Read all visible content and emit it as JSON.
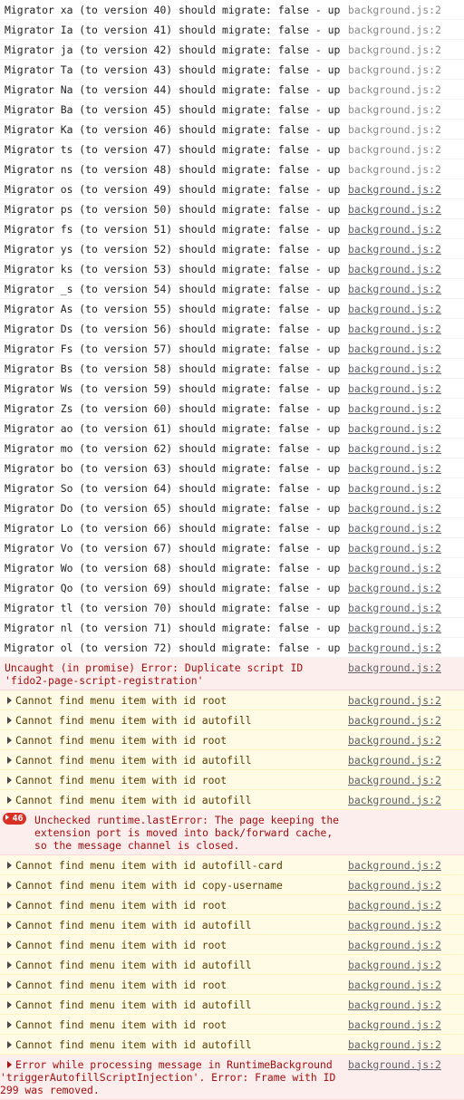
{
  "console": {
    "messages": [
      {
        "level": "log",
        "text": "Migrator xa (to version 40) should migrate: false - up",
        "source": "background.js:2",
        "link": false
      },
      {
        "level": "log",
        "text": "Migrator Ia (to version 41) should migrate: false - up",
        "source": "background.js:2",
        "link": false
      },
      {
        "level": "log",
        "text": "Migrator ja (to version 42) should migrate: false - up",
        "source": "background.js:2",
        "link": false
      },
      {
        "level": "log",
        "text": "Migrator Ta (to version 43) should migrate: false - up",
        "source": "background.js:2",
        "link": false
      },
      {
        "level": "log",
        "text": "Migrator Na (to version 44) should migrate: false - up",
        "source": "background.js:2",
        "link": false
      },
      {
        "level": "log",
        "text": "Migrator Ba (to version 45) should migrate: false - up",
        "source": "background.js:2",
        "link": false
      },
      {
        "level": "log",
        "text": "Migrator Ka (to version 46) should migrate: false - up",
        "source": "background.js:2",
        "link": false
      },
      {
        "level": "log",
        "text": "Migrator ts (to version 47) should migrate: false - up",
        "source": "background.js:2",
        "link": false
      },
      {
        "level": "log",
        "text": "Migrator ns (to version 48) should migrate: false - up",
        "source": "background.js:2",
        "link": false
      },
      {
        "level": "log",
        "text": "Migrator os (to version 49) should migrate: false - up",
        "source": "background.js:2",
        "link": true
      },
      {
        "level": "log",
        "text": "Migrator ps (to version 50) should migrate: false - up",
        "source": "background.js:2",
        "link": true
      },
      {
        "level": "log",
        "text": "Migrator fs (to version 51) should migrate: false - up",
        "source": "background.js:2",
        "link": true
      },
      {
        "level": "log",
        "text": "Migrator ys (to version 52) should migrate: false - up",
        "source": "background.js:2",
        "link": true
      },
      {
        "level": "log",
        "text": "Migrator ks (to version 53) should migrate: false - up",
        "source": "background.js:2",
        "link": true
      },
      {
        "level": "log",
        "text": "Migrator _s (to version 54) should migrate: false - up",
        "source": "background.js:2",
        "link": true
      },
      {
        "level": "log",
        "text": "Migrator As (to version 55) should migrate: false - up",
        "source": "background.js:2",
        "link": true
      },
      {
        "level": "log",
        "text": "Migrator Ds (to version 56) should migrate: false - up",
        "source": "background.js:2",
        "link": true
      },
      {
        "level": "log",
        "text": "Migrator Fs (to version 57) should migrate: false - up",
        "source": "background.js:2",
        "link": true
      },
      {
        "level": "log",
        "text": "Migrator Bs (to version 58) should migrate: false - up",
        "source": "background.js:2",
        "link": true
      },
      {
        "level": "log",
        "text": "Migrator Ws (to version 59) should migrate: false - up",
        "source": "background.js:2",
        "link": true
      },
      {
        "level": "log",
        "text": "Migrator Zs (to version 60) should migrate: false - up",
        "source": "background.js:2",
        "link": true
      },
      {
        "level": "log",
        "text": "Migrator ao (to version 61) should migrate: false - up",
        "source": "background.js:2",
        "link": true
      },
      {
        "level": "log",
        "text": "Migrator mo (to version 62) should migrate: false - up",
        "source": "background.js:2",
        "link": true
      },
      {
        "level": "log",
        "text": "Migrator bo (to version 63) should migrate: false - up",
        "source": "background.js:2",
        "link": true
      },
      {
        "level": "log",
        "text": "Migrator So (to version 64) should migrate: false - up",
        "source": "background.js:2",
        "link": true
      },
      {
        "level": "log",
        "text": "Migrator Do (to version 65) should migrate: false - up",
        "source": "background.js:2",
        "link": true
      },
      {
        "level": "log",
        "text": "Migrator Lo (to version 66) should migrate: false - up",
        "source": "background.js:2",
        "link": true
      },
      {
        "level": "log",
        "text": "Migrator Vo (to version 67) should migrate: false - up",
        "source": "background.js:2",
        "link": true
      },
      {
        "level": "log",
        "text": "Migrator Wo (to version 68) should migrate: false - up",
        "source": "background.js:2",
        "link": true
      },
      {
        "level": "log",
        "text": "Migrator Qo (to version 69) should migrate: false - up",
        "source": "background.js:2",
        "link": true
      },
      {
        "level": "log",
        "text": "Migrator tl (to version 70) should migrate: false - up",
        "source": "background.js:2",
        "link": true
      },
      {
        "level": "log",
        "text": "Migrator nl (to version 71) should migrate: false - up",
        "source": "background.js:2",
        "link": true
      },
      {
        "level": "log",
        "text": "Migrator ol (to version 72) should migrate: false - up",
        "source": "background.js:2",
        "link": true
      },
      {
        "level": "error",
        "text": "Uncaught (in promise) Error: Duplicate script ID 'fido2-page-script-registration'",
        "source": "background.js:2",
        "link": true
      },
      {
        "level": "warning",
        "text": "Cannot find menu item with id root",
        "source": "background.js:2",
        "link": true,
        "expandable": true
      },
      {
        "level": "warning",
        "text": "Cannot find menu item with id autofill",
        "source": "background.js:2",
        "link": true,
        "expandable": true
      },
      {
        "level": "warning",
        "text": "Cannot find menu item with id root",
        "source": "background.js:2",
        "link": true,
        "expandable": true
      },
      {
        "level": "warning",
        "text": "Cannot find menu item with id autofill",
        "source": "background.js:2",
        "link": true,
        "expandable": true
      },
      {
        "level": "warning",
        "text": "Cannot find menu item with id root",
        "source": "background.js:2",
        "link": true,
        "expandable": true
      },
      {
        "level": "warning",
        "text": "Cannot find menu item with id autofill",
        "source": "background.js:2",
        "link": true,
        "expandable": true
      },
      {
        "level": "error",
        "badge": "46",
        "text": "Unchecked runtime.lastError: The page keeping the extension port is moved into back/forward cache, so the message channel is closed.",
        "source": "",
        "link": false
      },
      {
        "level": "warning",
        "text": "Cannot find menu item with id autofill-card",
        "source": "background.js:2",
        "link": true,
        "expandable": true
      },
      {
        "level": "warning",
        "text": "Cannot find menu item with id copy-username",
        "source": "background.js:2",
        "link": true,
        "expandable": true
      },
      {
        "level": "warning",
        "text": "Cannot find menu item with id root",
        "source": "background.js:2",
        "link": true,
        "expandable": true
      },
      {
        "level": "warning",
        "text": "Cannot find menu item with id autofill",
        "source": "background.js:2",
        "link": true,
        "expandable": true
      },
      {
        "level": "warning",
        "text": "Cannot find menu item with id root",
        "source": "background.js:2",
        "link": true,
        "expandable": true
      },
      {
        "level": "warning",
        "text": "Cannot find menu item with id autofill",
        "source": "background.js:2",
        "link": true,
        "expandable": true
      },
      {
        "level": "warning",
        "text": "Cannot find menu item with id root",
        "source": "background.js:2",
        "link": true,
        "expandable": true
      },
      {
        "level": "warning",
        "text": "Cannot find menu item with id autofill",
        "source": "background.js:2",
        "link": true,
        "expandable": true
      },
      {
        "level": "warning",
        "text": "Cannot find menu item with id root",
        "source": "background.js:2",
        "link": true,
        "expandable": true
      },
      {
        "level": "warning",
        "text": "Cannot find menu item with id autofill",
        "source": "background.js:2",
        "link": true,
        "expandable": true
      },
      {
        "level": "error",
        "text": "Error while processing message in RuntimeBackground 'triggerAutofillScriptInjection'. Error: Frame with ID 299 was removed.",
        "source": "background.js:2",
        "link": true,
        "expandable": true
      }
    ]
  }
}
